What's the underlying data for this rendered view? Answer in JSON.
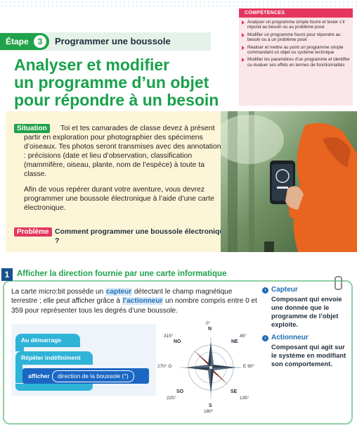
{
  "etape": {
    "prefix": "Étape",
    "number": "3",
    "title": "Programmer une boussole"
  },
  "main_title": [
    "Analyser et modifier",
    "un programme d’un objet",
    "pour répondre à un besoin"
  ],
  "competences": {
    "header": "COMPÉTENCES",
    "items": [
      "Analyser un programme simple fourni et tester s’il répond au besoin ou au problème posé",
      "Modifier un programme fourni pour répondre au besoin ou à un problème posé",
      "Réaliser et mettre au point un programme simple commandant un objet ou système technique",
      "Modifier les paramètres d’un programme et identifier ou évaluer ses effets en termes de fonctionnalités"
    ]
  },
  "situation": {
    "label": "Situation",
    "paragraph1": "Toi et tes camarades de classe devez à présent partir en exploration pour photographier des spécimens d’oiseaux. Tes photos seront transmises avec des annotations : précisions (date et lieu d’observation, classification (mammifère, oiseau, plante, nom de l’espèce) à toute ta classe.",
    "paragraph2": "Afin de vous repérer durant votre aventure, vous devrez programmer une boussole électronique à l’aide d’une carte électronique."
  },
  "probleme": {
    "label": "Problème",
    "text": "Comment programmer une boussole électronique ?"
  },
  "section1": {
    "number": "1",
    "title": "Afficher la direction fournie par une carte informatique",
    "text_part1": "La carte micro:bit possède un ",
    "term_capteur": "capteur",
    "text_part2": " détectant le champ magnétique terrestre ; elle peut afficher grâce à ",
    "term_actionneur": "l’actionneur",
    "text_part3": " un nombre compris entre 0 et 359 pour représenter tous les degrés d’une boussole."
  },
  "glossary": [
    {
      "term": "Capteur",
      "definition": "Composant qui envoie une donnée que le programme de l’objet exploite."
    },
    {
      "term": "Actionneur",
      "definition": "Composant qui agit sur le système en modifiant son comportement."
    }
  ],
  "blocks": {
    "on_start": "Au démarrage",
    "forever": "Répéter indéfiniment",
    "show": "afficher",
    "compass": "direction de la boussole (°)"
  },
  "compass": {
    "n_deg": "0°",
    "n": "N",
    "ne_deg": "45°",
    "ne": "NE",
    "e": "E 90°",
    "se": "SE",
    "se_deg": "135°",
    "s": "S",
    "s_deg": "180°",
    "so": "SO",
    "so_deg": "225°",
    "o": "270° O",
    "no": "NO",
    "no_deg": "315°"
  },
  "colors": {
    "green": "#1fa24a",
    "pink": "#e4365c",
    "blue": "#1e6db3",
    "cyan": "#2fb4d8"
  }
}
